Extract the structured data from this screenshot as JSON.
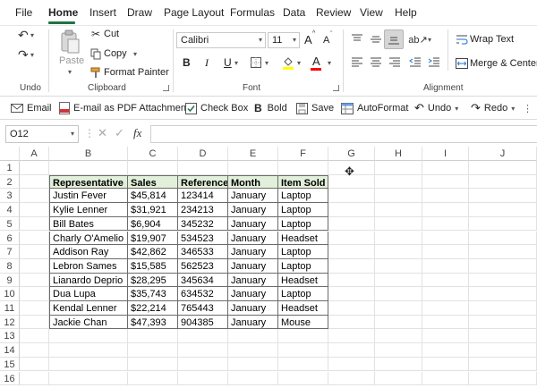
{
  "menu": {
    "items": [
      "File",
      "Home",
      "Insert",
      "Draw",
      "Page Layout",
      "Formulas",
      "Data",
      "Review",
      "View",
      "Help"
    ],
    "active": "Home"
  },
  "ribbon": {
    "undo": {
      "group_label": "Undo"
    },
    "clipboard": {
      "group_label": "Clipboard",
      "paste": "Paste",
      "cut": "Cut",
      "copy": "Copy",
      "format_painter": "Format Painter"
    },
    "font": {
      "group_label": "Font",
      "font_name": "Calibri",
      "font_size": "11",
      "bold": "B",
      "italic": "I",
      "underline": "U",
      "grow_font": "A",
      "shrink_font": "A",
      "font_color_letter": "A",
      "font_color": "#ff0000",
      "fill_color": "#ffff00"
    },
    "alignment": {
      "group_label": "Alignment",
      "wrap_text": "Wrap Text",
      "merge_center": "Merge & Center"
    }
  },
  "toolbar": {
    "email": "Email",
    "pdf": "E-mail as PDF Attachment",
    "checkbox": "Check Box",
    "bold_icon": "B",
    "bold": "Bold",
    "save": "Save",
    "autoformat": "AutoFormat",
    "undo": "Undo",
    "redo": "Redo"
  },
  "formula_bar": {
    "name_box": "O12",
    "fx": "fx",
    "formula": ""
  },
  "sheet": {
    "columns": [
      "A",
      "B",
      "C",
      "D",
      "E",
      "F",
      "G",
      "H",
      "I",
      "J"
    ],
    "rows": [
      "1",
      "2",
      "3",
      "4",
      "5",
      "6",
      "7",
      "8",
      "9",
      "10",
      "11",
      "12",
      "13",
      "14",
      "15",
      "16"
    ],
    "table": {
      "headers": [
        "Representative",
        "Sales",
        "Reference",
        "Month",
        "Item Sold"
      ],
      "header_fill": "#e2efda",
      "rows": [
        [
          "Justin Fever",
          "$45,814",
          "123414",
          "January",
          "Laptop"
        ],
        [
          "Kylie Lenner",
          "$31,921",
          "234213",
          "January",
          "Laptop"
        ],
        [
          "Bill Bates",
          "$6,904",
          "345232",
          "January",
          "Laptop"
        ],
        [
          "Charly O'Amelio",
          "$19,907",
          "534523",
          "January",
          "Headset"
        ],
        [
          "Addison Ray",
          "$42,862",
          "346533",
          "January",
          "Laptop"
        ],
        [
          "Lebron Sames",
          "$15,585",
          "562523",
          "January",
          "Laptop"
        ],
        [
          "Lianardo Deprio",
          "$28,295",
          "345634",
          "January",
          "Headset"
        ],
        [
          "Dua Lupa",
          "$35,743",
          "634532",
          "January",
          "Laptop"
        ],
        [
          "Kendal Lenner",
          "$22,214",
          "765443",
          "January",
          "Headset"
        ],
        [
          "Jackie Chan",
          "$47,393",
          "904385",
          "January",
          "Mouse"
        ]
      ]
    }
  },
  "colors": {
    "accent": "#217346",
    "header_fill": "#e2efda"
  }
}
